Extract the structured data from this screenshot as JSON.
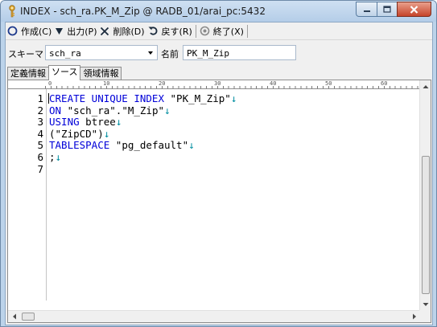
{
  "window": {
    "title": "INDEX - sch_ra.PK_M_Zip @ RADB_01/arai_pc:5432"
  },
  "toolbar": {
    "create_label": "作成(C)",
    "output_label": "出力(P)",
    "delete_label": "削除(D)",
    "revert_label": "戻す(R)",
    "exit_label": "終了(X)"
  },
  "form": {
    "schema_label": "スキーマ",
    "schema_value": "sch_ra",
    "name_label": "名前",
    "name_value": "PK_M_Zip"
  },
  "tabs": [
    {
      "label": "定義情報",
      "active": false
    },
    {
      "label": "ソース",
      "active": true
    },
    {
      "label": "領域情報",
      "active": false
    }
  ],
  "ruler": {
    "labels": [
      "0",
      "10",
      "20",
      "30",
      "40",
      "50",
      "60"
    ]
  },
  "editor": {
    "eol_marker": "↓",
    "lines": [
      {
        "num": "1",
        "segments": [
          {
            "t": "CREATE UNIQUE INDEX",
            "k": true
          },
          {
            "t": " \"PK_M_Zip\"",
            "k": false
          }
        ],
        "eol": true
      },
      {
        "num": "2",
        "segments": [
          {
            "t": "ON",
            "k": true
          },
          {
            "t": " \"sch_ra\".\"M_Zip\"",
            "k": false
          }
        ],
        "eol": true
      },
      {
        "num": "3",
        "segments": [
          {
            "t": "USING",
            "k": true
          },
          {
            "t": " btree",
            "k": false
          }
        ],
        "eol": true
      },
      {
        "num": "4",
        "segments": [
          {
            "t": "(\"ZipCD\")",
            "k": false
          }
        ],
        "eol": true
      },
      {
        "num": "5",
        "segments": [
          {
            "t": "TABLESPACE",
            "k": true
          },
          {
            "t": " \"pg_default\"",
            "k": false
          }
        ],
        "eol": true
      },
      {
        "num": "6",
        "segments": [
          {
            "t": ";",
            "k": false
          }
        ],
        "eol": true
      },
      {
        "num": "7",
        "segments": [],
        "eol": false
      }
    ]
  },
  "colors": {
    "keyword": "#0000d8",
    "eol_marker": "#008ea0",
    "titlebar": "#bcd3ea",
    "close_button": "#c6442a"
  }
}
